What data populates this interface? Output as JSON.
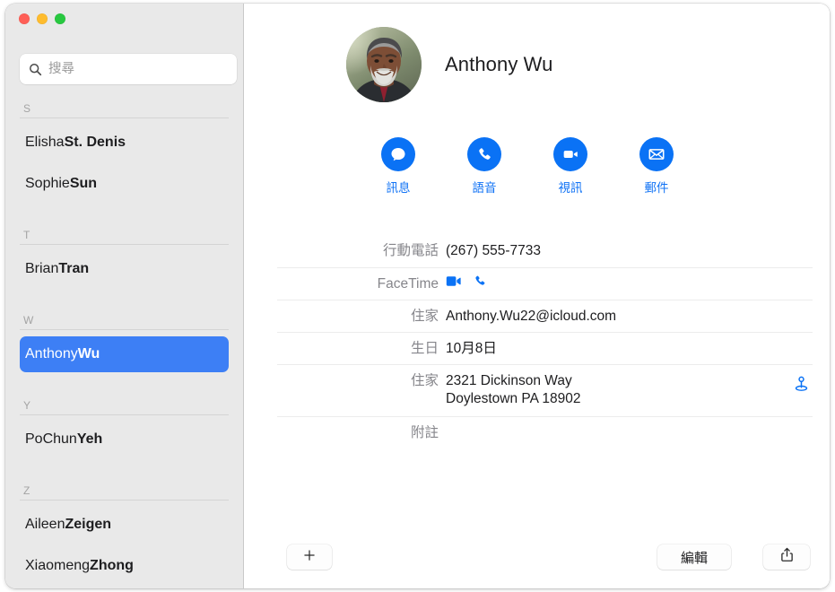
{
  "window": {
    "traffic_lights": [
      {
        "name": "close",
        "color": "#ff5f57"
      },
      {
        "name": "minimize",
        "color": "#febc2e"
      },
      {
        "name": "zoom",
        "color": "#28c840"
      }
    ]
  },
  "sidebar": {
    "search": {
      "placeholder": "搜尋",
      "value": "",
      "icon": "search-icon"
    },
    "sections": [
      {
        "letter": "S",
        "contacts": [
          {
            "first": "Elisha ",
            "last": "St. Denis",
            "selected": false
          },
          {
            "first": "Sophie ",
            "last": "Sun",
            "selected": false
          }
        ]
      },
      {
        "letter": "T",
        "contacts": [
          {
            "first": "Brian ",
            "last": "Tran",
            "selected": false
          }
        ]
      },
      {
        "letter": "W",
        "contacts": [
          {
            "first": "Anthony ",
            "last": "Wu",
            "selected": true
          }
        ]
      },
      {
        "letter": "Y",
        "contacts": [
          {
            "first": "PoChun ",
            "last": "Yeh",
            "selected": false
          }
        ]
      },
      {
        "letter": "Z",
        "contacts": [
          {
            "first": "Aileen ",
            "last": "Zeigen",
            "selected": false
          },
          {
            "first": "Xiaomeng ",
            "last": "Zhong",
            "selected": false
          }
        ]
      }
    ],
    "selection_color": "#3d7ff5",
    "background_color": "#e9e9e9"
  },
  "contact": {
    "name": "Anthony Wu",
    "avatar": "contact-photo",
    "actions": [
      {
        "icon": "message-bubble-icon",
        "label": "訊息"
      },
      {
        "icon": "phone-icon",
        "label": "語音"
      },
      {
        "icon": "video-camera-icon",
        "label": "視訊"
      },
      {
        "icon": "envelope-icon",
        "label": "郵件"
      }
    ],
    "action_color": "#0a72f5",
    "fields": [
      {
        "type": "phone",
        "label": "行動電話",
        "value": "(267) 555-7733"
      },
      {
        "type": "facetime",
        "label": "FaceTime",
        "value": "",
        "icons": [
          "facetime-video-icon",
          "facetime-audio-icon"
        ]
      },
      {
        "type": "email",
        "label": "住家",
        "value": "Anthony.Wu22@icloud.com"
      },
      {
        "type": "birthday",
        "label": "生日",
        "value": "10月8日"
      },
      {
        "type": "address",
        "label": "住家",
        "line1": "2321 Dickinson Way",
        "line2": "Doylestown PA 18902",
        "map_icon": "map-pin-icon"
      },
      {
        "type": "notes",
        "label": "附註",
        "value": ""
      }
    ]
  },
  "toolbar": {
    "add_label": "+",
    "add_icon": "plus-icon",
    "edit_label": "編輯",
    "share_icon": "share-icon"
  }
}
